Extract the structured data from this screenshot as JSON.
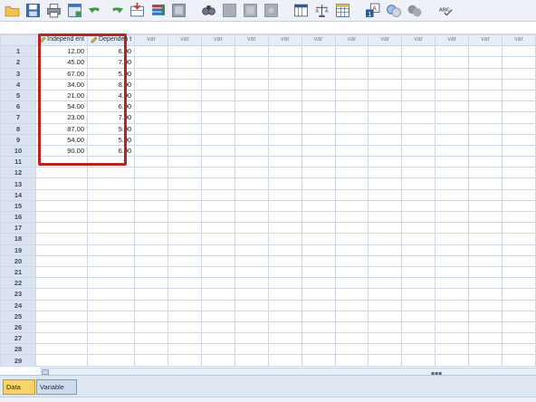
{
  "toolbar": {
    "icons": [
      "open-folder-icon",
      "save-icon",
      "print-icon",
      "dialog-recall-icon",
      "undo-icon",
      "redo-icon",
      "goto-case-icon",
      "goto-variable-icon",
      "variables-icon",
      "insert-cases-icon",
      "find-icon",
      "disabled-icon",
      "disabled-icon",
      "disabled-icon",
      "split-file-icon",
      "weight-cases-icon",
      "select-cases-icon",
      "value-labels-icon",
      "use-sets-icon",
      "show-all-icon",
      "spell-check-icon"
    ],
    "spell_label": "ABC"
  },
  "grid": {
    "columns": [
      {
        "label": "Independ ent",
        "named": true
      },
      {
        "label": "Dependen t",
        "named": true
      },
      {
        "label": "var",
        "named": false
      },
      {
        "label": "var",
        "named": false
      },
      {
        "label": "var",
        "named": false
      },
      {
        "label": "var",
        "named": false
      },
      {
        "label": "var",
        "named": false
      },
      {
        "label": "var",
        "named": false
      },
      {
        "label": "var",
        "named": false
      },
      {
        "label": "var",
        "named": false
      },
      {
        "label": "var",
        "named": false
      },
      {
        "label": "var",
        "named": false
      },
      {
        "label": "var",
        "named": false
      },
      {
        "label": "var",
        "named": false
      }
    ],
    "rows": [
      {
        "n": "1",
        "cells": [
          "12.00",
          "6.00"
        ]
      },
      {
        "n": "2",
        "cells": [
          "45.00",
          "7.00"
        ]
      },
      {
        "n": "3",
        "cells": [
          "67.00",
          "5.00"
        ]
      },
      {
        "n": "4",
        "cells": [
          "34.00",
          "8.00"
        ]
      },
      {
        "n": "5",
        "cells": [
          "21.00",
          "4.00"
        ]
      },
      {
        "n": "6",
        "cells": [
          "54.00",
          "6.00"
        ]
      },
      {
        "n": "7",
        "cells": [
          "23.00",
          "7.00"
        ]
      },
      {
        "n": "8",
        "cells": [
          "87.00",
          "9.00"
        ]
      },
      {
        "n": "9",
        "cells": [
          "54.00",
          "5.00"
        ]
      },
      {
        "n": "10",
        "cells": [
          "90.00",
          "6.00"
        ]
      },
      {
        "n": "11",
        "cells": [
          "",
          ""
        ]
      },
      {
        "n": "12",
        "cells": [
          "",
          ""
        ]
      },
      {
        "n": "13",
        "cells": [
          "",
          ""
        ]
      },
      {
        "n": "14",
        "cells": [
          "",
          ""
        ]
      },
      {
        "n": "15",
        "cells": [
          "",
          ""
        ]
      },
      {
        "n": "16",
        "cells": [
          "",
          ""
        ]
      },
      {
        "n": "17",
        "cells": [
          "",
          ""
        ]
      },
      {
        "n": "18",
        "cells": [
          "",
          ""
        ]
      },
      {
        "n": "19",
        "cells": [
          "",
          ""
        ]
      },
      {
        "n": "20",
        "cells": [
          "",
          ""
        ]
      },
      {
        "n": "21",
        "cells": [
          "",
          ""
        ]
      },
      {
        "n": "22",
        "cells": [
          "",
          ""
        ]
      },
      {
        "n": "23",
        "cells": [
          "",
          ""
        ]
      },
      {
        "n": "24",
        "cells": [
          "",
          ""
        ]
      },
      {
        "n": "25",
        "cells": [
          "",
          ""
        ]
      },
      {
        "n": "26",
        "cells": [
          "",
          ""
        ]
      },
      {
        "n": "27",
        "cells": [
          "",
          ""
        ]
      },
      {
        "n": "28",
        "cells": [
          "",
          ""
        ]
      },
      {
        "n": "29",
        "cells": [
          "",
          ""
        ]
      }
    ]
  },
  "tabs": {
    "data_view": "Data View",
    "variable_view": "Variable View"
  },
  "colors": {
    "highlight": "#b8251b",
    "active_tab": "#f7d46a"
  }
}
